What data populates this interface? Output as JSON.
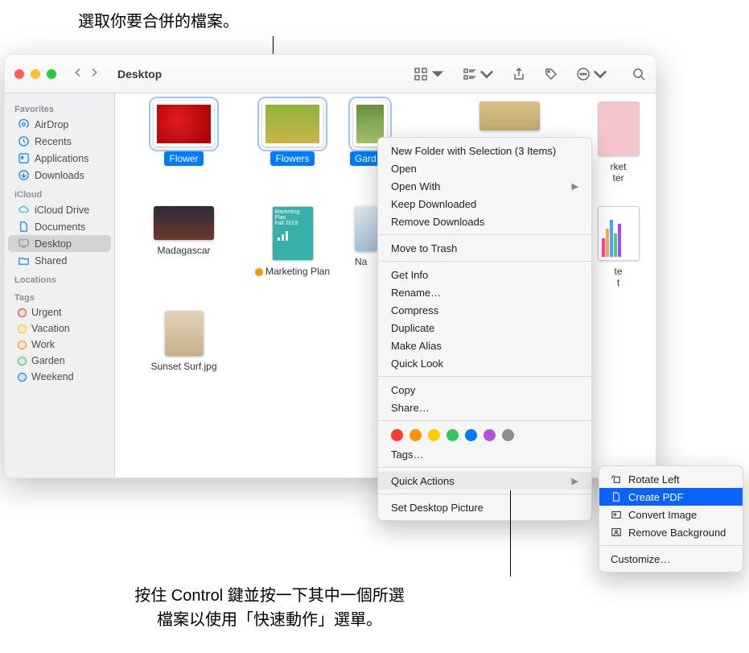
{
  "annotations": {
    "top": "選取你要合併的檔案。",
    "bottom_l1": "按住 Control 鍵並按一下其中一個所選",
    "bottom_l2": "檔案以使用「快速動作」選單。"
  },
  "window": {
    "title": "Desktop"
  },
  "sidebar": {
    "favorites_heading": "Favorites",
    "favorites": [
      {
        "label": "AirDrop",
        "icon": "airdrop"
      },
      {
        "label": "Recents",
        "icon": "clock"
      },
      {
        "label": "Applications",
        "icon": "apps"
      },
      {
        "label": "Downloads",
        "icon": "download"
      }
    ],
    "icloud_heading": "iCloud",
    "icloud": [
      {
        "label": "iCloud Drive",
        "icon": "cloud"
      },
      {
        "label": "Documents",
        "icon": "doc"
      },
      {
        "label": "Desktop",
        "icon": "desktop",
        "selected": true
      },
      {
        "label": "Shared",
        "icon": "shared"
      }
    ],
    "locations_heading": "Locations",
    "tags_heading": "Tags",
    "tags": [
      {
        "label": "Urgent",
        "color": "#ff3b30"
      },
      {
        "label": "Vacation",
        "color": "#ffcc00"
      },
      {
        "label": "Work",
        "color": "#ff9500"
      },
      {
        "label": "Garden",
        "color": "#34c759"
      },
      {
        "label": "Weekend",
        "color": "#007aff"
      }
    ]
  },
  "files": {
    "row1": [
      {
        "name": "Flower",
        "selected": true,
        "art": "art-red",
        "shape": "photo"
      },
      {
        "name": "Flowers",
        "selected": true,
        "art": "art-flowers",
        "shape": "photo"
      },
      {
        "name": "Gard",
        "selected": true,
        "art": "art-garden",
        "shape": "photo",
        "truncated": true
      },
      {
        "name": "",
        "art": "art-beach",
        "shape": "photo"
      },
      {
        "name": "rket\nter",
        "art": "art-pink",
        "shape": "doc"
      }
    ],
    "row2": [
      {
        "name": "Madagascar",
        "art": "art-mada",
        "shape": "photo"
      },
      {
        "name": "Marketing Plan",
        "art": "art-plan",
        "shape": "doc",
        "tag": "#ff9500"
      },
      {
        "name": "Na",
        "art": "art-ski",
        "shape": "photo"
      },
      {
        "name": "",
        "shape": "none"
      },
      {
        "name": "te\nt",
        "art": "art-chart",
        "shape": "doc"
      }
    ],
    "row3": [
      {
        "name": "Sunset Surf.jpg",
        "art": "art-surf",
        "shape": "photo"
      }
    ]
  },
  "context_menu": {
    "new_folder": "New Folder with Selection (3 Items)",
    "open": "Open",
    "open_with": "Open With",
    "keep_downloaded": "Keep Downloaded",
    "remove_downloads": "Remove Downloads",
    "move_to_trash": "Move to Trash",
    "get_info": "Get Info",
    "rename": "Rename…",
    "compress": "Compress",
    "duplicate": "Duplicate",
    "make_alias": "Make Alias",
    "quick_look": "Quick Look",
    "copy": "Copy",
    "share": "Share…",
    "tags": "Tags…",
    "quick_actions": "Quick Actions",
    "set_desktop": "Set Desktop Picture",
    "tag_colors": [
      "#ff3b30",
      "#ff9500",
      "#ffcc00",
      "#34c759",
      "#007aff",
      "#af52de",
      "#8e8e93"
    ]
  },
  "quick_actions_menu": {
    "rotate_left": "Rotate Left",
    "create_pdf": "Create PDF",
    "convert_image": "Convert Image",
    "remove_background": "Remove Background",
    "customize": "Customize…"
  }
}
